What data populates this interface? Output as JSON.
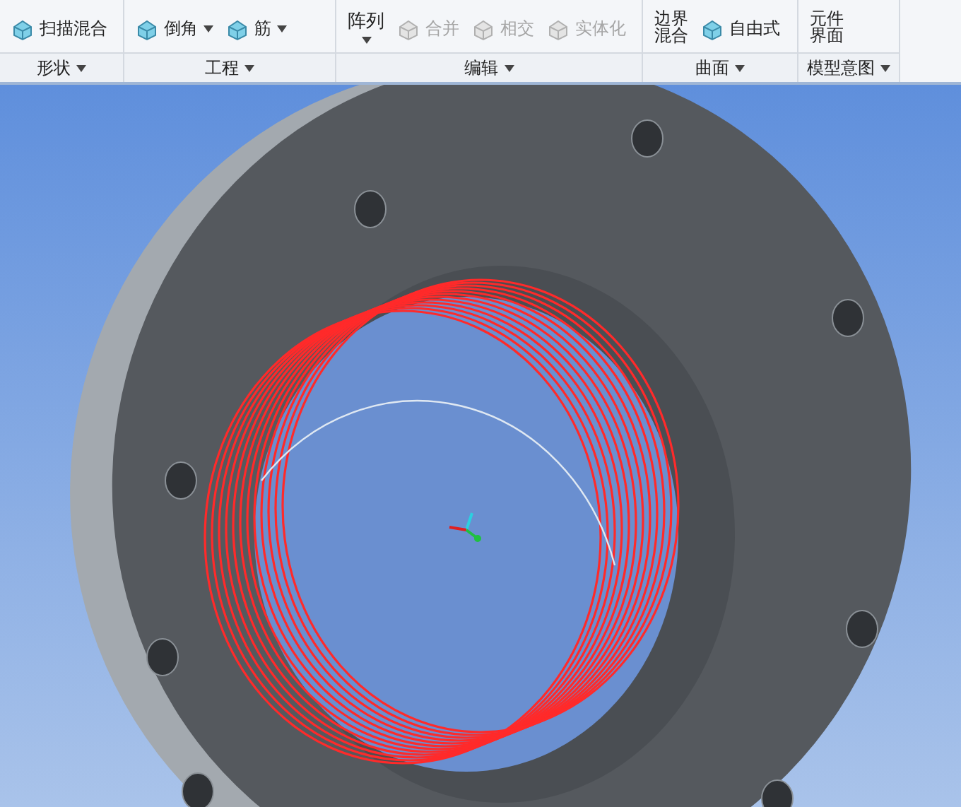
{
  "ribbon": {
    "groups": [
      {
        "label": "形状",
        "items": [
          {
            "kind": "small",
            "label": "扫描混合",
            "disabled": false,
            "dropdown": false
          }
        ]
      },
      {
        "label": "工程",
        "items": [
          {
            "kind": "small",
            "label": "倒角",
            "disabled": false,
            "dropdown": true
          },
          {
            "kind": "small",
            "label": "筋",
            "disabled": false,
            "dropdown": true
          }
        ]
      },
      {
        "label": "编辑",
        "items": [
          {
            "kind": "large",
            "label": "阵列",
            "disabled": false,
            "dropdown": true
          },
          {
            "kind": "small",
            "label": "合并",
            "disabled": true,
            "dropdown": false
          },
          {
            "kind": "small",
            "label": "相交",
            "disabled": true,
            "dropdown": false
          },
          {
            "kind": "small",
            "label": "实体化",
            "disabled": true,
            "dropdown": false
          }
        ]
      },
      {
        "label": "曲面",
        "items": [
          {
            "kind": "stacked",
            "label": "边界混合",
            "disabled": false,
            "dropdown": false
          },
          {
            "kind": "small",
            "label": "自由式",
            "disabled": false,
            "dropdown": false
          }
        ]
      },
      {
        "label": "模型意图",
        "items": [
          {
            "kind": "stacked",
            "label": "元件界面",
            "disabled": false,
            "dropdown": false
          }
        ]
      }
    ]
  }
}
